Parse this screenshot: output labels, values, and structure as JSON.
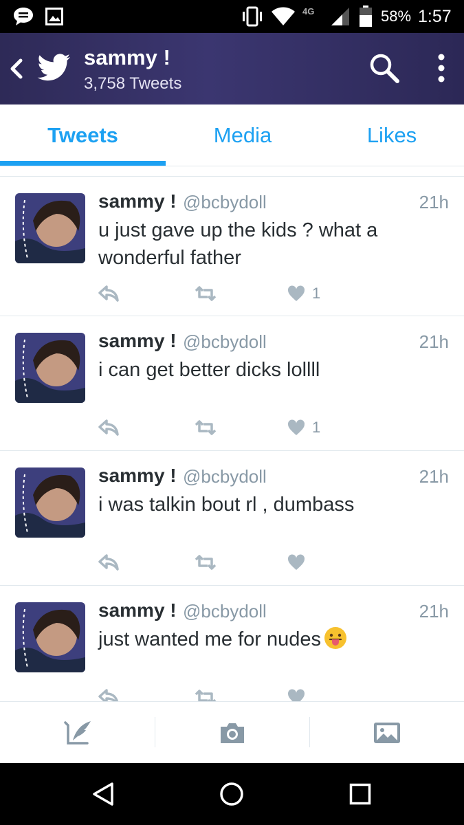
{
  "status_bar": {
    "network": "4G",
    "battery": "58%",
    "time": "1:57",
    "icons": [
      "chat-bubble-icon",
      "image-icon",
      "vibrate-icon",
      "wifi-icon",
      "signal-icon",
      "battery-icon"
    ]
  },
  "header": {
    "title": "sammy !",
    "subtitle": "3,758 Tweets",
    "icons": [
      "back-icon",
      "twitter-bird-icon",
      "search-icon",
      "overflow-menu-icon"
    ]
  },
  "tabs": [
    {
      "label": "Tweets",
      "active": true
    },
    {
      "label": "Media",
      "active": false
    },
    {
      "label": "Likes",
      "active": false
    }
  ],
  "tweets": [
    {
      "name": "sammy !",
      "handle": "@bcbydoll",
      "time": "21h",
      "text": "u just gave up the kids ? what a wonderful father",
      "likes": "1"
    },
    {
      "name": "sammy !",
      "handle": "@bcbydoll",
      "time": "21h",
      "text": "i can get better dicks lollll",
      "likes": "1"
    },
    {
      "name": "sammy !",
      "handle": "@bcbydoll",
      "time": "21h",
      "text": "i was talkin bout rl , dumbass",
      "likes": ""
    },
    {
      "name": "sammy !",
      "handle": "@bcbydoll",
      "time": "21h",
      "text": "just wanted me for nudes",
      "emoji": "face-with-tongue",
      "likes": ""
    }
  ],
  "bottom_bar": {
    "icons": [
      "compose-tweet-icon",
      "camera-icon",
      "gallery-icon"
    ]
  },
  "colors": {
    "accent": "#1da1f2",
    "header_bg": "#35316a",
    "muted": "#8899a6",
    "text": "#292f33",
    "action_icon": "#aab8c2"
  }
}
